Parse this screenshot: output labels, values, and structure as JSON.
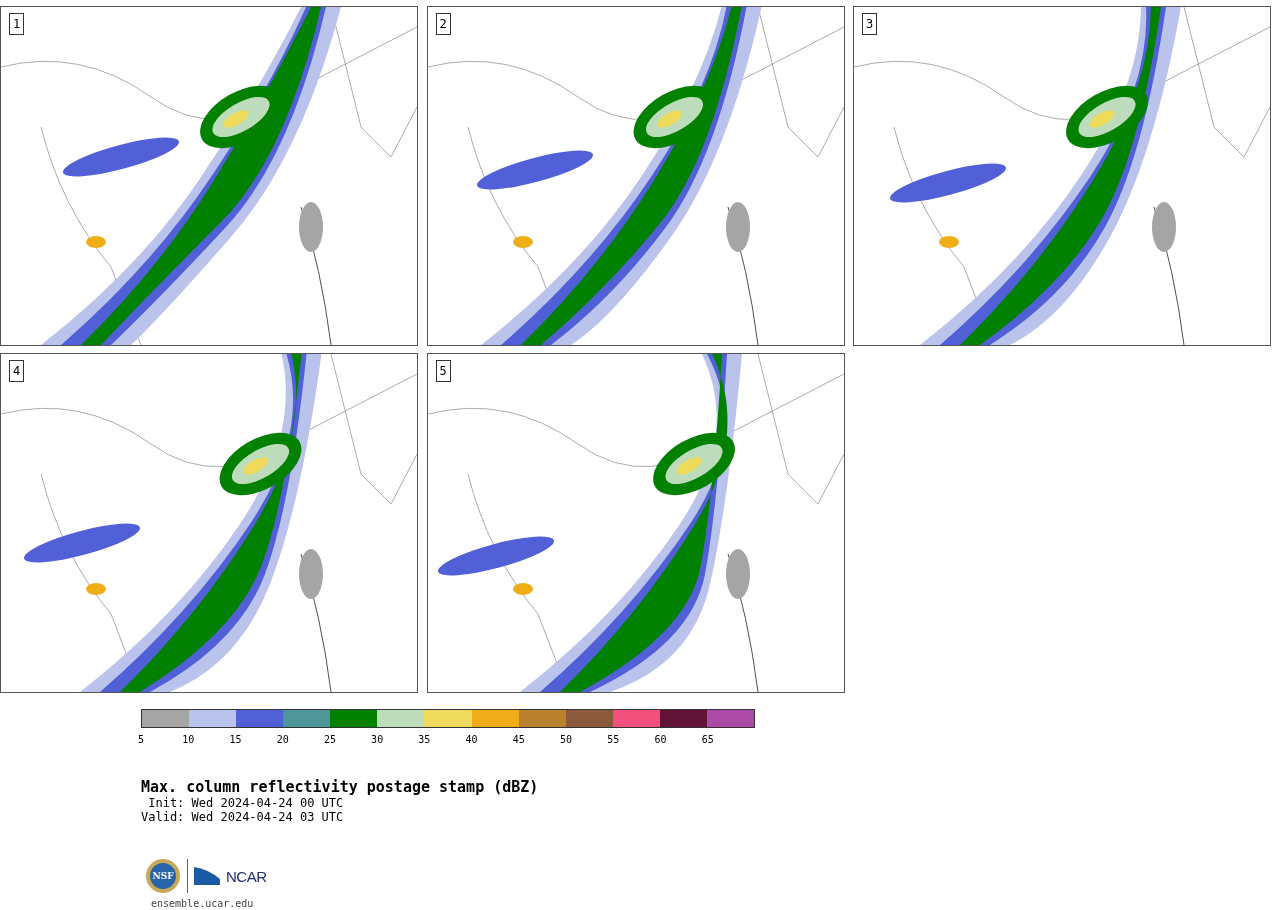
{
  "panels": [
    {
      "label": "1"
    },
    {
      "label": "2"
    },
    {
      "label": "3"
    },
    {
      "label": "4"
    },
    {
      "label": "5"
    }
  ],
  "colorbar": {
    "segments": [
      {
        "color": "#a5a5a5"
      },
      {
        "color": "#b9c3ec"
      },
      {
        "color": "#5160d6"
      },
      {
        "color": "#4e969a"
      },
      {
        "color": "#028100"
      },
      {
        "color": "#bddcbb"
      },
      {
        "color": "#eedb5c"
      },
      {
        "color": "#efae17"
      },
      {
        "color": "#b9812e"
      },
      {
        "color": "#8b5a3c"
      },
      {
        "color": "#f3507e"
      },
      {
        "color": "#621437"
      },
      {
        "color": "#ad4aa8"
      }
    ],
    "ticks": [
      "5",
      "10",
      "15",
      "20",
      "25",
      "30",
      "35",
      "40",
      "45",
      "50",
      "55",
      "60",
      "65"
    ]
  },
  "title": "Max. column reflectivity postage stamp (dBZ)",
  "init": " Init: Wed 2024-04-24 00 UTC",
  "valid": "Valid: Wed 2024-04-24 03 UTC",
  "logo": {
    "seal_text": "NSF",
    "wordmark": "NCAR"
  },
  "url": "ensemble.ucar.edu"
}
